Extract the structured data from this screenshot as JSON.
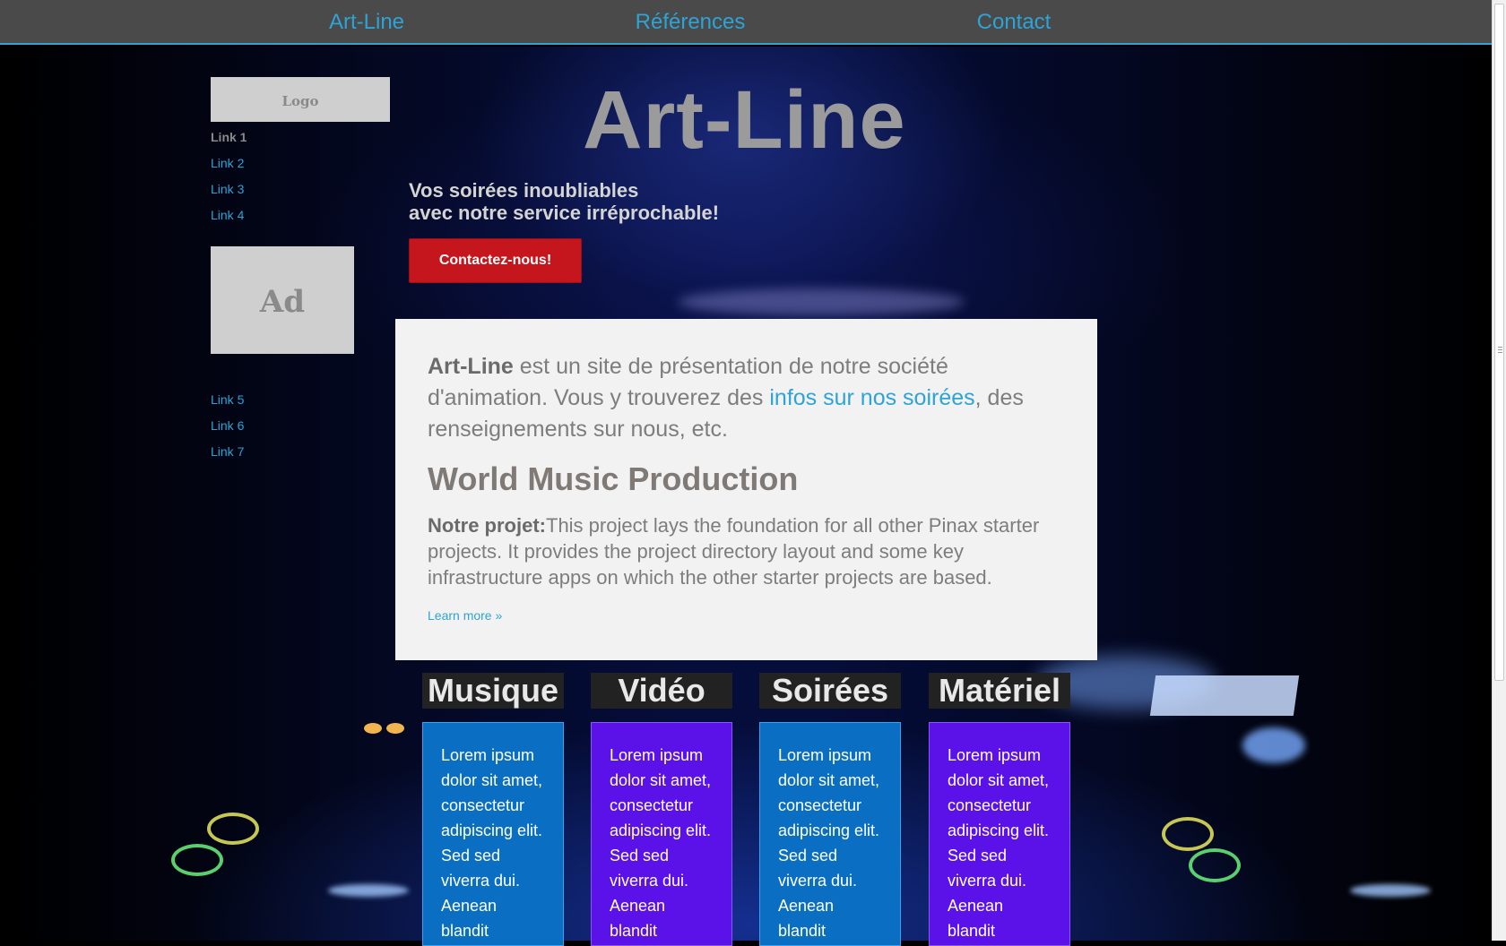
{
  "nav": {
    "items": [
      "Art-Line",
      "Références",
      "Contact"
    ]
  },
  "sidebar": {
    "logo": "Logo",
    "links_top": [
      "Link 1",
      "Link 2",
      "Link 3",
      "Link 4"
    ],
    "ad": "Ad",
    "links_bottom": [
      "Link 5",
      "Link 6",
      "Link 7"
    ]
  },
  "hero": {
    "title": "Art-Line",
    "tagline_line1": "Vos soirées inoubliables",
    "tagline_line2": "avec notre service irréprochable!",
    "cta": "Contactez-nous!"
  },
  "card": {
    "intro_brand": "Art-Line",
    "intro_text1": " est un site de présentation de notre société d'animation. Vous y trouverez des ",
    "intro_link": "infos sur nos soirées",
    "intro_text2": ", des renseignements sur nous, etc.",
    "heading": "World Music Production",
    "project_label": "Notre projet:",
    "project_text": "This project lays the foundation for all other Pinax starter projects. It provides the project directory layout and some key infrastructure apps on which the other starter projects are based.",
    "learn_more": "Learn more »"
  },
  "columns": [
    {
      "title": "Musique",
      "body": "Lorem ipsum dolor sit amet, consectetur adipiscing elit. Sed sed viverra dui. Aenean blandit",
      "color": "#0a6fc2"
    },
    {
      "title": "Vidéo",
      "body": "Lorem ipsum dolor sit amet, consectetur adipiscing elit. Sed sed viverra dui. Aenean blandit",
      "color": "#5b12e8"
    },
    {
      "title": "Soirées",
      "body": "Lorem ipsum dolor sit amet, consectetur adipiscing elit. Sed sed viverra dui. Aenean blandit",
      "color": "#0a6fc2"
    },
    {
      "title": "Matériel",
      "body": "Lorem ipsum dolor sit amet, consectetur adipiscing elit. Sed sed viverra dui. Aenean blandit",
      "color": "#5b12e8"
    }
  ],
  "colors": {
    "accent": "#2ea3d6",
    "nav_bg": "#4a4a4a",
    "cta": "#c4161c",
    "card_bg": "#f2f2f2"
  }
}
